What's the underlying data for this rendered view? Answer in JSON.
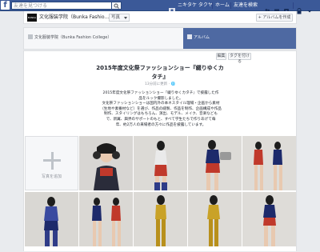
{
  "topbar": {
    "logo": "f",
    "search_placeholder": "友達を見つける",
    "user_name": "ニキタケ タクヤ",
    "home_label": "ホーム",
    "find_friends_label": "友達を検索"
  },
  "owner": {
    "avatar_text": "BUNKA",
    "name": "文化服装学院（Bunka Fashio...",
    "select_value": "写真",
    "create_album_label": "+ アルバムを作成"
  },
  "tabs": [
    {
      "label": "文化服装学院（Bunka Fashion College）"
    },
    {
      "label": ""
    },
    {
      "label": "アルバム"
    }
  ],
  "album": {
    "edit_label": "編集",
    "tag_label": "タグを付ける",
    "title_line1": "2015年度文化祭ファッションショー『綴りゆくカ",
    "title_line2": "タチ』",
    "meta": "13分前に更新 · 🌐",
    "desc_line1": "2015年度文化祭ファッションショー『綴りゆくカタチ』で披露した作",
    "desc_line2": "品をルック撮影しました。",
    "desc_line3": "文化祭ファッションショーは国内外の本ネスタイル理場・企画から素材",
    "desc_line4": "（生地や素養材など）を選び、作品の縫製、作品を制作、企画構成や作品",
    "desc_line5": "制作、スタイリングはもちろん、演出、モデル、メイク、音楽なども",
    "desc_line6": "で、新翼、興界のサポートのもと、すべて学生たちで作りあげて毎",
    "desc_line7": "年、約2万人の来場者の方々に作品を披露しています。",
    "add_photo_label": "写真を追加"
  },
  "colors": {
    "brand_blue": "#3b5998",
    "active_tab": "#4e69a2",
    "page_bg": "#e9ebee"
  }
}
